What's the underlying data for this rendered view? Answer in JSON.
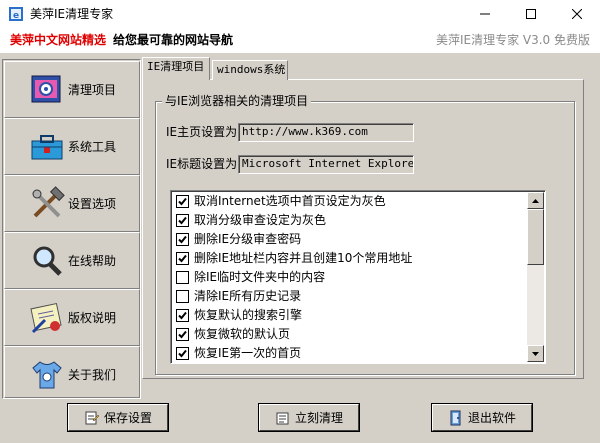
{
  "window": {
    "title": "美萍IE清理专家"
  },
  "banner": {
    "brand": "美萍中文网站精选",
    "tagline": "给您最可靠的网站导航",
    "version": "美萍IE清理专家 V3.0 免费版"
  },
  "sidebar": {
    "items": [
      {
        "label": "清理项目",
        "icon": "ie-cleanup-icon"
      },
      {
        "label": "系统工具",
        "icon": "toolbox-icon"
      },
      {
        "label": "设置选项",
        "icon": "wrench-hammer-icon"
      },
      {
        "label": "在线帮助",
        "icon": "magnifier-icon"
      },
      {
        "label": "版权说明",
        "icon": "certificate-icon"
      },
      {
        "label": "关于我们",
        "icon": "tshirt-icon"
      }
    ]
  },
  "tabs": [
    {
      "label": "IE清理项目",
      "active": true
    },
    {
      "label": "windows系统",
      "active": false
    }
  ],
  "group": {
    "title": "与IE浏览器相关的清理项目",
    "homepage_label": "IE主页设置为",
    "homepage_value": "http://www.k369.com",
    "titlebar_label": "IE标题设置为",
    "titlebar_value": "Microsoft Internet Explorer"
  },
  "cleanup_items": [
    {
      "label": "取消Internet选项中首页设定为灰色",
      "checked": true
    },
    {
      "label": "取消分级审查设定为灰色",
      "checked": true
    },
    {
      "label": "删除IE分级审查密码",
      "checked": true
    },
    {
      "label": "删除IE地址栏内容并且创建10个常用地址",
      "checked": true
    },
    {
      "label": "除IE临时文件夹中的内容",
      "checked": false
    },
    {
      "label": "清除IE所有历史记录",
      "checked": false
    },
    {
      "label": "恢复默认的搜索引擎",
      "checked": true
    },
    {
      "label": "恢复微软的默认页",
      "checked": true
    },
    {
      "label": "恢复IE第一次的首页",
      "checked": true
    }
  ],
  "buttons": {
    "save": "保存设置",
    "clean": "立刻清理",
    "exit": "退出软件"
  },
  "colors": {
    "face": "#d4d0c8",
    "brand_red": "#e10000",
    "version_gray": "#8a8a8a"
  }
}
